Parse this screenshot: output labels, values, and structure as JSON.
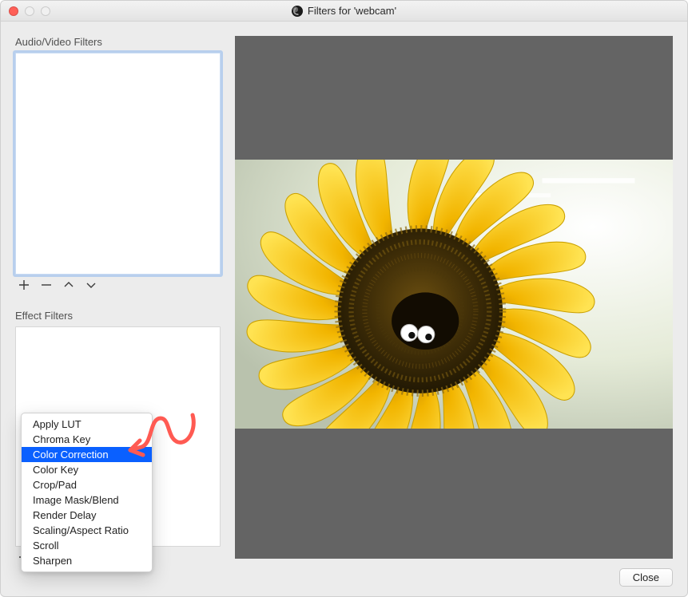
{
  "window": {
    "title": "Filters for 'webcam'"
  },
  "sidebar": {
    "av_label": "Audio/Video Filters",
    "fx_label": "Effect Filters"
  },
  "buttons": {
    "close": "Close"
  },
  "context_menu": {
    "items": [
      "Apply LUT",
      "Chroma Key",
      "Color Correction",
      "Color Key",
      "Crop/Pad",
      "Image Mask/Blend",
      "Render Delay",
      "Scaling/Aspect Ratio",
      "Scroll",
      "Sharpen"
    ],
    "selected_index": 2
  },
  "colors": {
    "annotation": "#ff5a52",
    "selection": "#0a60ff"
  }
}
